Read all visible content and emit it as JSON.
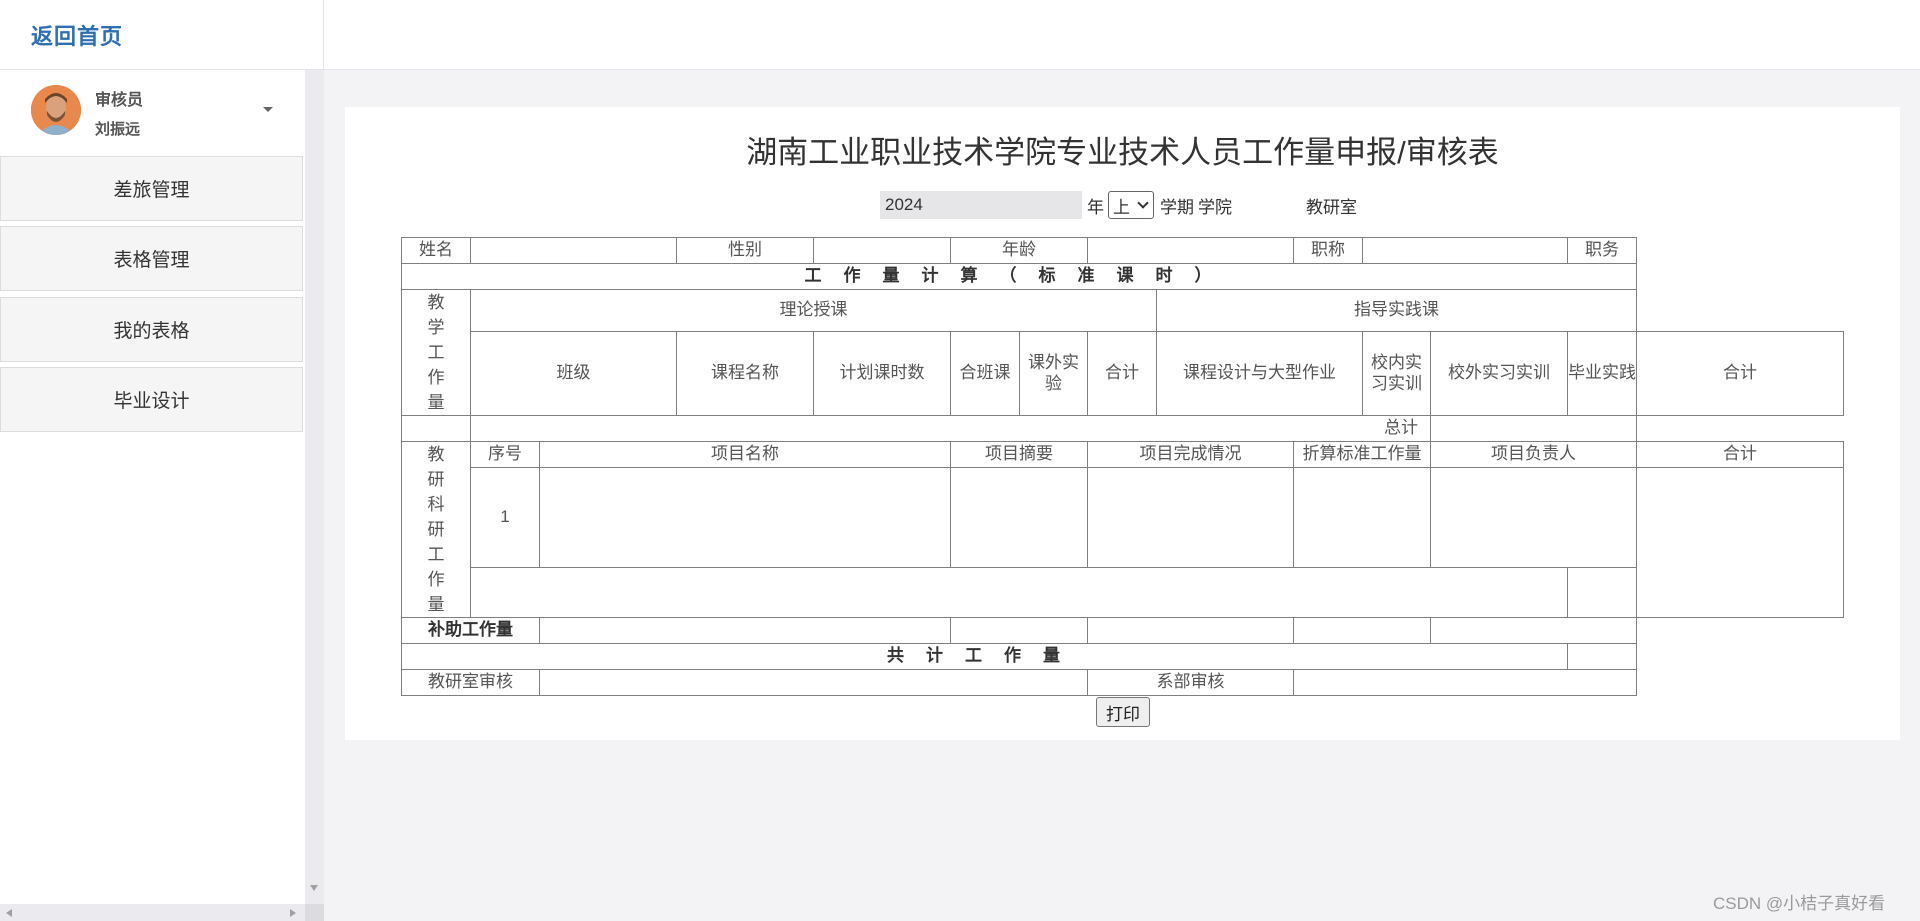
{
  "header": {
    "home_link": "返回首页"
  },
  "user": {
    "role": "审核员",
    "name": "刘振远"
  },
  "sidebar": {
    "items": [
      {
        "label": "差旅管理"
      },
      {
        "label": "表格管理"
      },
      {
        "label": "我的表格"
      },
      {
        "label": "毕业设计"
      }
    ]
  },
  "form": {
    "title": "湖南工业职业技术学院专业技术人员工作量申报/审核表",
    "year_value": "2024",
    "year_suffix": "年",
    "semester_selected": "上",
    "semester_suffix": "学期",
    "school_label": "学院",
    "office_label": "教研室",
    "row1": {
      "name": "姓名",
      "gender": "性别",
      "age": "年龄",
      "title": "职称",
      "position": "职务"
    },
    "calc_header": "工作量计算（标准课时）",
    "teaching": {
      "label": "教学工作量",
      "theory": "理论授课",
      "practice": "指导实践课",
      "cols": {
        "class": "班级",
        "course": "课程名称",
        "planned_hours": "计划课时数",
        "merged": "合班课",
        "extra_exp": "课外实验",
        "subtotal": "合计",
        "design": "课程设计与大型作业",
        "in_school": "校内实习实训",
        "out_school": "校外实习实训",
        "graduation": "毕业实践",
        "subtotal2": "合计"
      }
    },
    "total_label": "总计",
    "research": {
      "label": "教研科研工作量",
      "cols": {
        "seq": "序号",
        "name": "项目名称",
        "summary": "项目摘要",
        "completion": "项目完成情况",
        "converted": "折算标准工作量",
        "leader": "项目负责人",
        "subtotal": "合计"
      },
      "row1_seq": "1"
    },
    "aux_label": "补助工作量",
    "grand_total": "共计工作量",
    "office_review": "教研室审核",
    "dept_review": "系部审核",
    "print_button": "打印"
  },
  "watermark": "CSDN @小桔子真好看"
}
